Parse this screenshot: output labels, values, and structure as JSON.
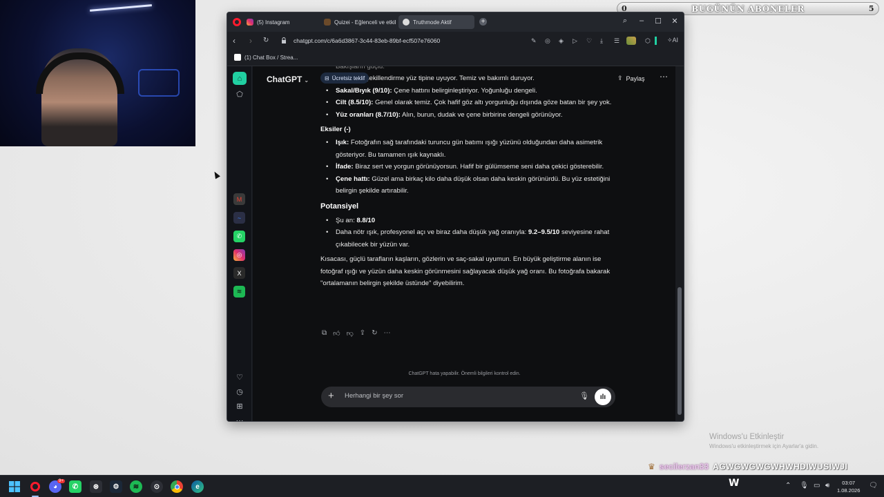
{
  "overlay": {
    "subscribers": {
      "left_count": "0",
      "title": "BUGÜNÜN ABONELER",
      "right_count": "5"
    },
    "ticker": {
      "user": "secilerzan33",
      "message": "AGWGWGWGWHWHDIWUSIWJI"
    }
  },
  "browser": {
    "tabs": [
      {
        "label": "(5) Instagram",
        "icon": "instagram-icon"
      },
      {
        "label": "Quizei - Eğlenceli ve etkil",
        "icon": "quiz-icon"
      },
      {
        "label": "Truthmode Aktif",
        "icon": "chatgpt-icon"
      }
    ],
    "url": "chatgpt.com/c/6a6d3867-3c44-83eb-89bf-ecf507e76060",
    "bookmark": "(1) Chat Box / Strea...",
    "ai_label": "AI"
  },
  "chat": {
    "brand": "ChatGPT",
    "offer": "Ücretsiz teklif",
    "share": "Paylaş",
    "partial_top": "Bakışların güçlü.",
    "partial_line": "...esim ve şekillendirme yüz tipine uyuyor. Temiz ve bakımlı duruyor.",
    "pros": [
      {
        "title": "Sakal/Bıyık (9/10):",
        "text": " Çene hattını belirginleştiriyor. Yoğunluğu dengeli."
      },
      {
        "title": "Cilt (8.5/10):",
        "text": " Genel olarak temiz. Çok hafif göz altı yorgunluğu dışında göze batan bir şey yok."
      },
      {
        "title": "Yüz oranları (8.7/10):",
        "text": " Alın, burun, dudak ve çene birbirine dengeli görünüyor."
      }
    ],
    "cons_heading": "Eksiler (-)",
    "cons": [
      {
        "title": "Işık:",
        "text": " Fotoğrafın sağ tarafındaki turuncu gün batımı ışığı yüzünü olduğundan daha asimetrik gösteriyor. Bu tamamen ışık kaynaklı."
      },
      {
        "title": "İfade:",
        "text": " Biraz sert ve yorgun görünüyorsun. Hafif bir gülümseme seni daha çekici gösterebilir."
      },
      {
        "title": "Çene hattı:",
        "text": " Güzel ama birkaç kilo daha düşük olsan daha keskin görünürdü. Bu yüz estetiğini belirgin şekilde artırabilir."
      }
    ],
    "potential_heading": "Potansiyel",
    "potential_now_label": "Şu an: ",
    "potential_now_value": "8.8/10",
    "potential_text_a": "Daha nötr ışık, profesyonel açı ve biraz daha düşük yağ oranıyla: ",
    "potential_range": "9.2–9.5/10",
    "potential_text_b": " seviyesine rahat çıkabilecek bir yüzün var.",
    "summary": "Kısacası, güçlü tarafların kaşların, gözlerin ve saç-sakal uyumun. En büyük geliştirme alanın ise fotoğraf ışığı ve yüzün daha keskin görünmesini sağlayacak düşük yağ oranı. Bu fotoğrafa bakarak \"ortalamanın belirgin şekilde üstünde\" diyebilirim.",
    "disclaimer": "ChatGPT hata yapabilir. Önemli bilgileri kontrol edin.",
    "composer_placeholder": "Herhangi bir şey sor"
  },
  "windows": {
    "activate_title": "Windows'u Etkinleştir",
    "activate_sub": "Windows'u etkinleştirmek için Ayarlar'a gidin.",
    "time": "03:07",
    "date": "1.08.2026",
    "discord_badge": "9+"
  },
  "colors": {
    "accent": "#21d0a2",
    "opera_red": "#ff1b2d",
    "chat_bg": "#0e0f11"
  }
}
